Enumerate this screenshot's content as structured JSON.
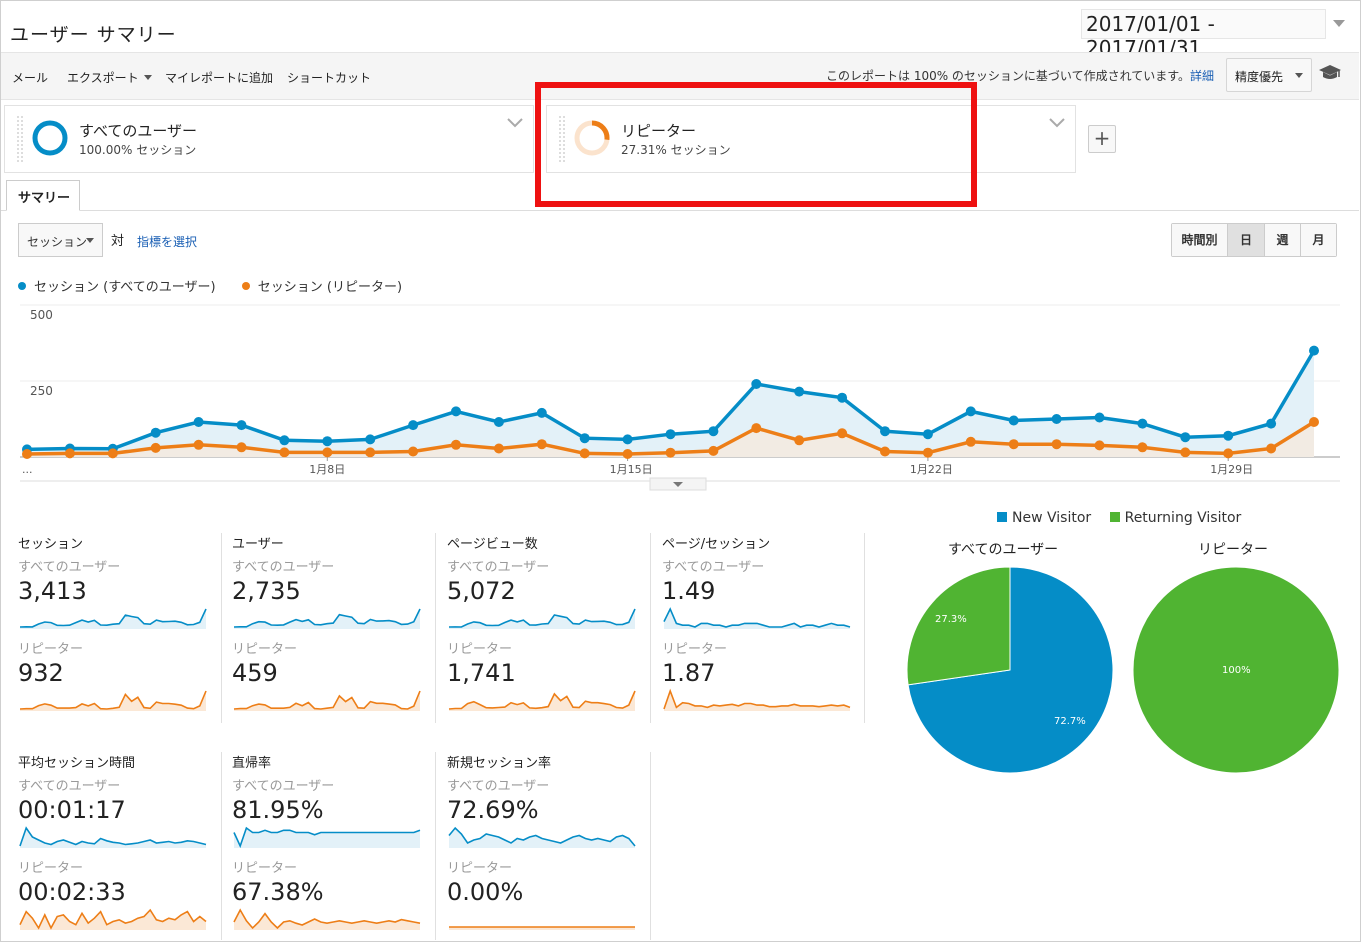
{
  "header": {
    "title": "ユーザー サマリー",
    "date_range": "2017/01/01 - 2017/01/31"
  },
  "toolbar": {
    "mail": "メール",
    "export": "エクスポート",
    "add_to_dashboard": "マイレポートに追加",
    "shortcut": "ショートカット",
    "sampling_note": "このレポートは 100% のセッションに基づいて作成されています。",
    "details_link": "詳細",
    "precision": "精度優先"
  },
  "segments": [
    {
      "name": "すべてのユーザー",
      "pct": "100.00% セッション",
      "color": "#058dc7"
    },
    {
      "name": "リピーター",
      "pct": "27.31% セッション",
      "color": "#ed7e17"
    }
  ],
  "add_segment": "+",
  "tab": "サマリー",
  "controls": {
    "metric": "セッション",
    "vs": "対",
    "pick_metric": "指標を選択",
    "periods": [
      "時間別",
      "日",
      "週",
      "月"
    ],
    "active_period": "日"
  },
  "colors": {
    "all_users": "#058dc7",
    "repeaters": "#ed7e17",
    "new_visitor": "#058dc7",
    "returning_visitor": "#50b432"
  },
  "chart_data": [
    {
      "type": "line",
      "legend": [
        "セッション (すべてのユーザー)",
        "セッション (リピーター)"
      ],
      "y_ticks": [
        "500",
        "250"
      ],
      "ylim": [
        0,
        500
      ],
      "x_ticks": [
        {
          "label": "...",
          "day": 1
        },
        {
          "label": "1月8日",
          "day": 8
        },
        {
          "label": "1月15日",
          "day": 15
        },
        {
          "label": "1月22日",
          "day": 22
        },
        {
          "label": "1月29日",
          "day": 29
        }
      ],
      "x": [
        1,
        2,
        3,
        4,
        5,
        6,
        7,
        8,
        9,
        10,
        11,
        12,
        13,
        14,
        15,
        16,
        17,
        18,
        19,
        20,
        21,
        22,
        23,
        24,
        25,
        26,
        27,
        28,
        29,
        30,
        31
      ],
      "series": [
        {
          "name": "セッション (すべてのユーザー)",
          "values": [
            25,
            28,
            27,
            80,
            115,
            105,
            55,
            52,
            58,
            105,
            150,
            115,
            145,
            62,
            58,
            75,
            85,
            240,
            215,
            195,
            85,
            75,
            150,
            120,
            125,
            130,
            110,
            65,
            70,
            110,
            350
          ]
        },
        {
          "name": "セッション (リピーター)",
          "values": [
            10,
            12,
            12,
            30,
            40,
            32,
            15,
            15,
            15,
            18,
            40,
            28,
            42,
            12,
            10,
            14,
            20,
            95,
            55,
            78,
            18,
            14,
            50,
            42,
            42,
            38,
            32,
            15,
            12,
            28,
            115
          ]
        }
      ]
    },
    {
      "type": "pie",
      "title": "すべてのユーザー",
      "legend": [
        "New Visitor",
        "Returning Visitor"
      ],
      "categories": [
        "New Visitor",
        "Returning Visitor"
      ],
      "values": [
        72.7,
        27.3
      ],
      "labels": [
        "72.7%",
        "27.3%"
      ]
    },
    {
      "type": "pie",
      "title": "リピーター",
      "categories": [
        "Returning Visitor"
      ],
      "values": [
        100
      ],
      "labels": [
        "100%"
      ]
    }
  ],
  "metrics": [
    {
      "title": "セッション",
      "seg_a": "すべてのユーザー",
      "val_a": "3,413",
      "seg_b": "リピーター",
      "val_b": "932",
      "spark_a": [
        25,
        28,
        27,
        80,
        115,
        105,
        55,
        52,
        58,
        105,
        150,
        115,
        145,
        62,
        58,
        75,
        85,
        240,
        215,
        195,
        85,
        75,
        150,
        120,
        125,
        130,
        110,
        65,
        70,
        110,
        350
      ],
      "spark_b": [
        10,
        12,
        12,
        30,
        40,
        32,
        15,
        15,
        15,
        18,
        40,
        28,
        42,
        12,
        10,
        14,
        20,
        95,
        55,
        78,
        18,
        14,
        50,
        42,
        42,
        38,
        32,
        15,
        12,
        28,
        115
      ]
    },
    {
      "title": "ユーザー",
      "seg_a": "すべてのユーザー",
      "val_a": "2,735",
      "seg_b": "リピーター",
      "val_b": "459",
      "spark_a": [
        20,
        22,
        22,
        60,
        85,
        80,
        45,
        42,
        46,
        80,
        110,
        88,
        108,
        50,
        47,
        60,
        68,
        170,
        155,
        140,
        66,
        60,
        112,
        92,
        95,
        98,
        85,
        52,
        55,
        85,
        240
      ],
      "spark_b": [
        8,
        9,
        9,
        16,
        20,
        18,
        10,
        10,
        10,
        12,
        22,
        16,
        24,
        9,
        8,
        10,
        12,
        40,
        26,
        36,
        11,
        10,
        26,
        22,
        22,
        20,
        18,
        9,
        8,
        15,
        52
      ]
    },
    {
      "title": "ページビュー数",
      "seg_a": "すべてのユーザー",
      "val_a": "5,072",
      "seg_b": "リピーター",
      "val_b": "1,741",
      "spark_a": [
        40,
        42,
        40,
        110,
        160,
        140,
        80,
        76,
        80,
        145,
        200,
        160,
        200,
        90,
        85,
        110,
        120,
        320,
        290,
        260,
        120,
        110,
        200,
        165,
        170,
        175,
        150,
        95,
        100,
        150,
        460
      ],
      "spark_b": [
        15,
        20,
        20,
        70,
        90,
        60,
        28,
        26,
        30,
        35,
        80,
        60,
        78,
        26,
        22,
        28,
        40,
        170,
        100,
        145,
        34,
        30,
        95,
        80,
        80,
        70,
        60,
        30,
        24,
        55,
        200
      ]
    },
    {
      "title": "ページ/セッション",
      "seg_a": "すべてのユーザー",
      "val_a": "1.49",
      "seg_b": "リピーター",
      "val_b": "1.87",
      "spark_a": [
        1.6,
        2.3,
        1.5,
        1.4,
        1.4,
        1.3,
        1.5,
        1.5,
        1.4,
        1.4,
        1.3,
        1.4,
        1.4,
        1.5,
        1.5,
        1.5,
        1.4,
        1.3,
        1.3,
        1.3,
        1.4,
        1.5,
        1.3,
        1.4,
        1.4,
        1.3,
        1.4,
        1.5,
        1.4,
        1.4,
        1.3
      ],
      "spark_b": [
        1.5,
        3.8,
        1.7,
        2.3,
        2.2,
        1.9,
        1.9,
        1.7,
        2.0,
        1.9,
        2.0,
        2.1,
        1.9,
        2.2,
        2.2,
        2.0,
        2.0,
        1.8,
        1.8,
        1.9,
        1.9,
        2.1,
        1.9,
        1.9,
        1.9,
        1.8,
        1.9,
        2.0,
        1.9,
        2.0,
        1.7
      ]
    }
  ],
  "metrics2": [
    {
      "title": "平均セッション時間",
      "seg_a": "すべてのユーザー",
      "val_a": "00:01:17",
      "seg_b": "リピーター",
      "val_b": "00:02:33",
      "spark_a": [
        60,
        180,
        120,
        100,
        80,
        70,
        90,
        100,
        85,
        70,
        90,
        80,
        75,
        110,
        95,
        85,
        80,
        70,
        75,
        80,
        90,
        100,
        80,
        85,
        90,
        80,
        85,
        95,
        90,
        80,
        70
      ],
      "spark_b": [
        80,
        160,
        120,
        60,
        140,
        60,
        130,
        140,
        100,
        80,
        150,
        90,
        120,
        160,
        80,
        100,
        110,
        90,
        100,
        120,
        130,
        170,
        110,
        100,
        120,
        110,
        140,
        160,
        100,
        130,
        100
      ]
    },
    {
      "title": "直帰率",
      "seg_a": "すべてのユーザー",
      "val_a": "81.95%",
      "seg_b": "リピーター",
      "val_b": "67.38%",
      "spark_a": [
        82,
        76,
        84,
        82,
        82,
        83,
        82,
        82,
        83,
        83,
        82,
        82,
        82,
        81,
        82,
        82,
        82,
        82,
        82,
        82,
        82,
        82,
        82,
        82,
        82,
        82,
        82,
        82,
        82,
        82,
        83
      ],
      "spark_b": [
        70,
        90,
        72,
        60,
        70,
        84,
        70,
        60,
        70,
        72,
        68,
        65,
        70,
        75,
        70,
        68,
        70,
        72,
        70,
        68,
        70,
        72,
        70,
        68,
        70,
        72,
        70,
        74,
        72,
        70,
        68
      ]
    },
    {
      "title": "新規セッション率",
      "seg_a": "すべてのユーザー",
      "val_a": "72.69%",
      "seg_b": "リピーター",
      "val_b": "0.00%",
      "spark_a": [
        75,
        80,
        76,
        70,
        72,
        73,
        76,
        75,
        74,
        72,
        70,
        73,
        72,
        74,
        75,
        73,
        72,
        71,
        70,
        72,
        74,
        75,
        73,
        72,
        73,
        72,
        71,
        74,
        75,
        73,
        68
      ],
      "spark_b": [
        0,
        0,
        0,
        0,
        0,
        0,
        0,
        0,
        0,
        0,
        0,
        0,
        0,
        0,
        0,
        0,
        0,
        0,
        0,
        0,
        0,
        0,
        0,
        0,
        0,
        0,
        0,
        0,
        0,
        0,
        0
      ]
    }
  ]
}
